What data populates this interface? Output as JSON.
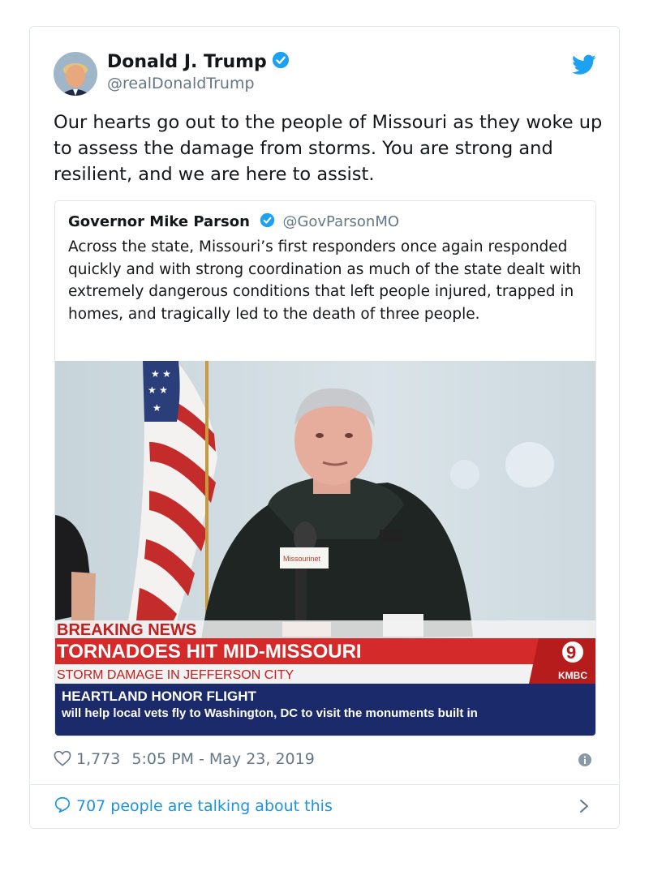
{
  "author": {
    "name": "Donald J. Trump",
    "handle": "@realDonaldTrump"
  },
  "tweet": {
    "text": "Our hearts go out to the people of Missouri as they woke up to assess the damage from storms. You are strong and resilient, and we are here to assist.",
    "likes": "1,773",
    "timestamp": "5:05 PM - May 23, 2019",
    "conversation": "707 people are talking about this"
  },
  "quoted": {
    "name": "Governor Mike Parson",
    "handle": "@GovParsonMO",
    "text": "Across the state, Missouri’s first responders once again responded quickly and with strong coordination as much of the state dealt with extremely dangerous conditions that left people injured, trapped in homes, and tragically led to the death of three people."
  },
  "media": {
    "breaking": "BREAKING NEWS",
    "headline": "TORNADOES HIT MID-MISSOURI",
    "subhead": "STORM DAMAGE IN JEFFERSON CITY",
    "ticker_title": "HEARTLAND HONOR FLIGHT",
    "ticker_text": "will help local vets fly to Washington, DC to visit the monuments built in",
    "station_number": "9",
    "station": "KMBC",
    "mic_label": "Missourinet"
  },
  "colors": {
    "link": "#1b95e0",
    "verified": "#1da1f2",
    "muted": "#657786",
    "border": "#e1e8ed"
  },
  "icons": [
    "verified-badge-icon",
    "twitter-bird-icon",
    "heart-icon",
    "info-icon",
    "reply-bubble-icon",
    "chevron-right-icon"
  ]
}
